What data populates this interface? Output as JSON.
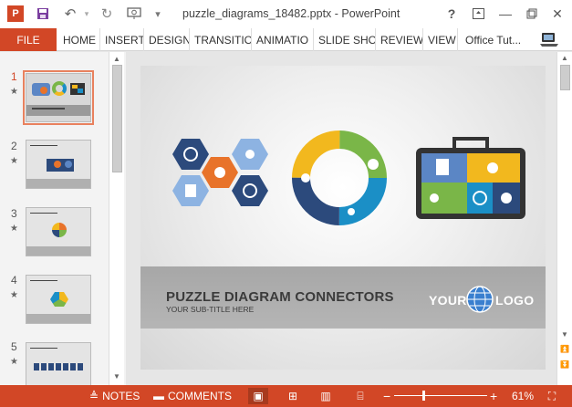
{
  "window": {
    "title": "puzzle_diagrams_18482.pptx - PowerPoint",
    "help": "?",
    "minimize": "—",
    "close": "✕"
  },
  "quick_access": {
    "app_icon": "powerpoint-app-icon",
    "save_icon": "save-icon",
    "undo_icon": "undo-icon",
    "redo_icon": "redo-icon",
    "start_icon": "start-from-beginning-icon",
    "customize_icon": "customize-icon"
  },
  "ribbon": {
    "file": "FILE",
    "tabs": [
      "HOME",
      "INSERT",
      "DESIGN",
      "TRANSITIO",
      "ANIMATIO",
      "SLIDE SHO",
      "REVIEW",
      "VIEW"
    ],
    "account": "Office Tut..."
  },
  "thumbnails": [
    {
      "number": "1",
      "active": true
    },
    {
      "number": "2",
      "active": false
    },
    {
      "number": "3",
      "active": false
    },
    {
      "number": "4",
      "active": false
    },
    {
      "number": "5",
      "active": false
    }
  ],
  "slide": {
    "title": "PUZZLE DIAGRAM CONNECTORS",
    "subtitle": "YOUR SUB-TITLE HERE",
    "logo_left": "YOUR",
    "logo_right": "LOGO"
  },
  "statusbar": {
    "notes": "NOTES",
    "comments": "COMMENTS",
    "zoom_minus": "−",
    "zoom_plus": "+",
    "zoom_level": "61%",
    "zoom_fraction": 0.3
  },
  "colors": {
    "accent": "#d24726",
    "puzzle_navy": "#2c4a7c",
    "puzzle_blue": "#5b86c5",
    "puzzle_light_blue": "#8db3e2",
    "puzzle_orange": "#e8732a",
    "puzzle_green": "#7ab648",
    "puzzle_yellow": "#f2b81e",
    "puzzle_teal": "#1b8fc6"
  }
}
